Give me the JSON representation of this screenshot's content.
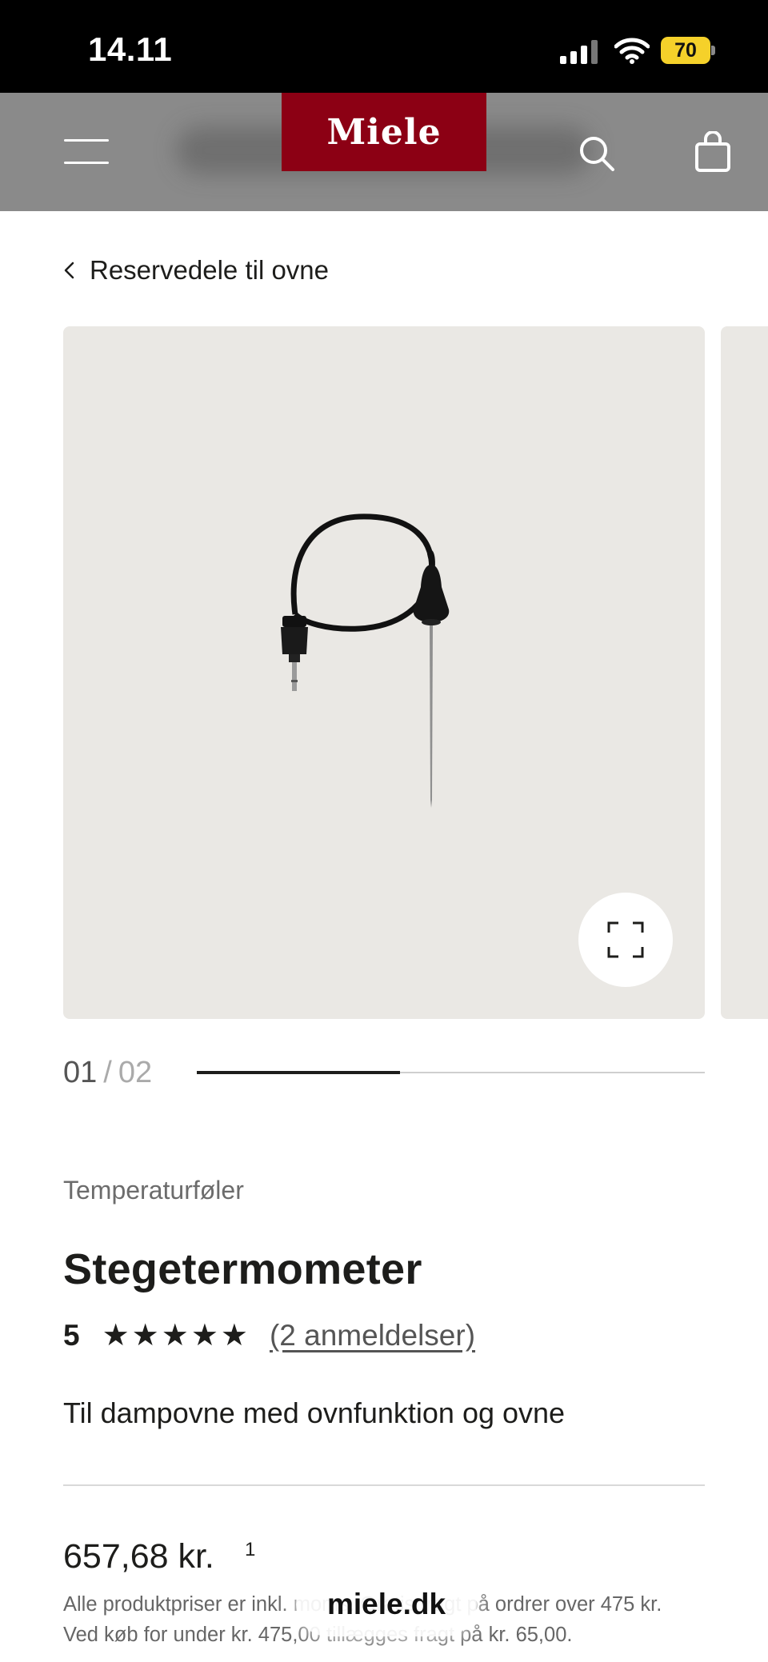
{
  "status_bar": {
    "time": "14.11",
    "battery_level": "70"
  },
  "header": {
    "brand": "Miele"
  },
  "breadcrumb": {
    "label": "Reservedele til ovne"
  },
  "gallery": {
    "current": "01",
    "separator": "/",
    "total": "02",
    "progress": 0.4
  },
  "product": {
    "category": "Temperaturføler",
    "title": "Stegetermometer",
    "rating_value": "5",
    "stars": 5,
    "reviews_label": "(2 anmeldelser)",
    "subtitle": "Til dampovne med ovnfunktion og ovne",
    "price": "657,68 kr.",
    "price_footnote": "1",
    "price_note_line1": "Alle produktpriser er inkl. moms. Gratis fragt på ordrer over 475 kr.",
    "price_note_line2": "Ved køb for under kr. 475,00 tillægges fragt på kr. 65,00."
  },
  "browser": {
    "url": "miele.dk"
  },
  "colors": {
    "brand_red": "#8c0014",
    "header_gray": "#8a8a8a",
    "image_bg": "#eae8e4",
    "battery_yellow": "#f5d12a"
  }
}
